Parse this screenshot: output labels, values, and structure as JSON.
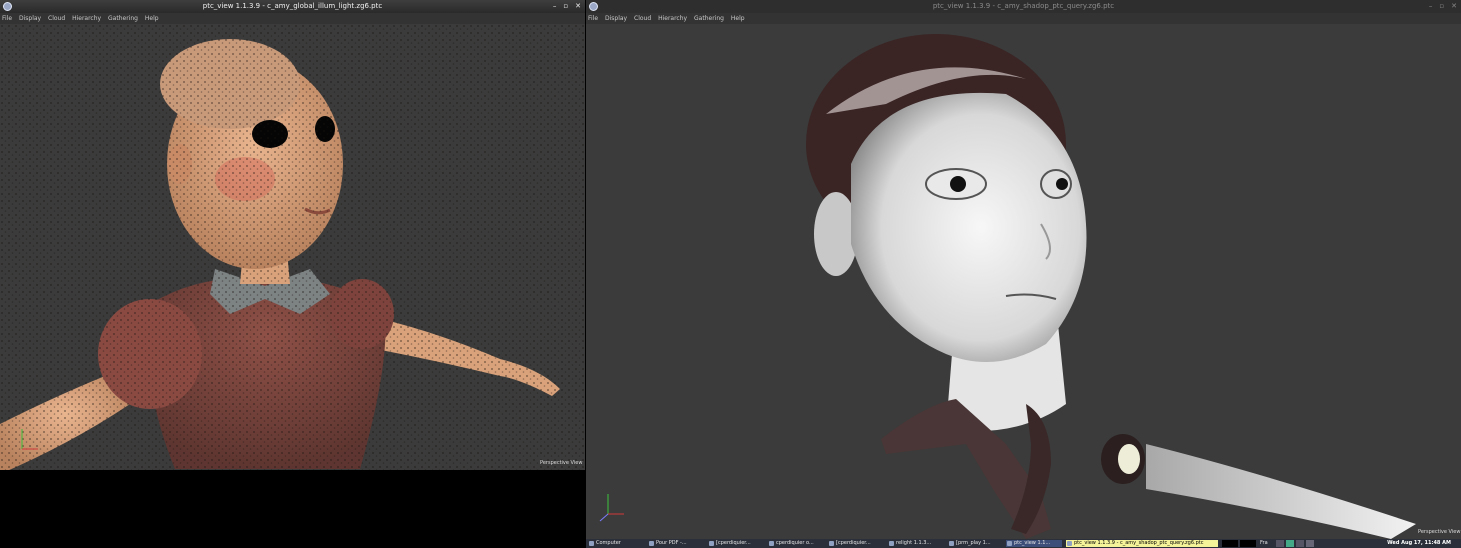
{
  "left_window": {
    "title": "ptc_view 1.1.3.9 - c_amy_global_illum_light.zg6.ptc",
    "controls": [
      "–",
      "▫",
      "✕"
    ],
    "menu": [
      "File",
      "Display",
      "Cloud",
      "Hierarchy",
      "Gathering",
      "Help"
    ],
    "viewport_label": "Perspective View"
  },
  "right_window": {
    "title": "ptc_view 1.1.3.9 - c_amy_shadop_ptc_query.zg6.ptc",
    "controls": [
      "–",
      "▫",
      "✕"
    ],
    "menu": [
      "File",
      "Display",
      "Cloud",
      "Hierarchy",
      "Gathering",
      "Help"
    ],
    "viewport_label": "Perspective View"
  },
  "taskbar": {
    "tasks": [
      {
        "label": "Computer",
        "icon": "computer-icon"
      },
      {
        "label": "Pour PDF -...",
        "icon": "folder-icon"
      },
      {
        "label": "[cperdiquier...",
        "icon": "terminal-icon"
      },
      {
        "label": "cperdiquier o...",
        "icon": "terminal-icon"
      },
      {
        "label": "[cperdiquier...",
        "icon": "terminal-icon"
      },
      {
        "label": "relight 1.1.3...",
        "icon": "app-icon"
      },
      {
        "label": "[prm_play 1...",
        "icon": "app-icon"
      },
      {
        "label": "ptc_view 1.1...",
        "icon": "app-icon"
      },
      {
        "label": "ptc_view 1.1.3.9 - c_amy_shadop_ptc_query.zg6.ptc",
        "icon": "app-icon"
      }
    ],
    "tray_label": "Fra",
    "clock": "Wed Aug 17, 11:48 AM"
  },
  "colors": {
    "viewport_bg": "#3b3b3b",
    "active_task": "#f4f39a",
    "taskbar_bg": "#2a2f3a"
  }
}
